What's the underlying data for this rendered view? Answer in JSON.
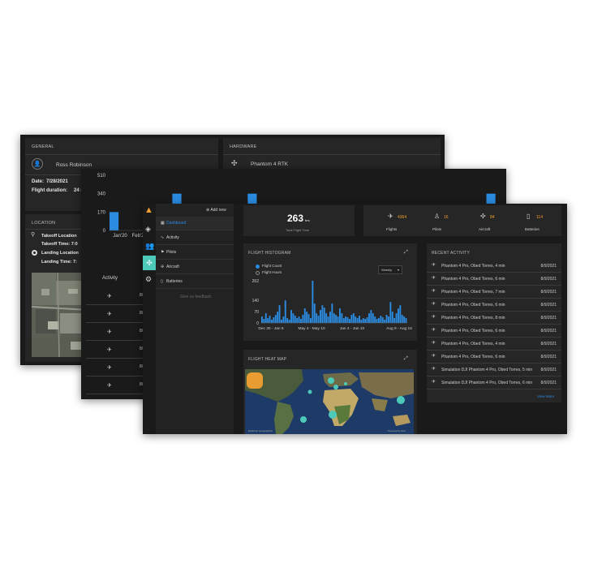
{
  "w1": {
    "general": {
      "title": "GENERAL",
      "pilot": "Ross Robinson",
      "date_label": "Date:",
      "date": "7/28/2021",
      "duration_label": "Flight duration:",
      "duration": "24 mi"
    },
    "hardware": {
      "title": "HARDWARE",
      "aircraft": "Phantom 4 RTK"
    },
    "location": {
      "title": "LOCATION",
      "takeoff_location": "Takeoff Location",
      "takeoff_time_label": "Takeoff Time: 7:0",
      "landing_location": "Landing Location",
      "landing_time_label": "Landing Time: 7:"
    }
  },
  "w2": {
    "chart_data": {
      "type": "bar",
      "yticks": [
        "510",
        "340",
        "170",
        "0"
      ],
      "xticks": [
        "Jan'20",
        "Feb'2"
      ],
      "ylim": [
        0,
        510
      ],
      "values": [
        170,
        0,
        0,
        0,
        0,
        340,
        0,
        0,
        90,
        0,
        0,
        340,
        0,
        0,
        0,
        0,
        0,
        0,
        0,
        0,
        0,
        0,
        0,
        0,
        0,
        0,
        0,
        0,
        60,
        150,
        340
      ]
    },
    "activity_header": "Activity",
    "row_prefix": "8/",
    "rows": 7
  },
  "w3": {
    "sidebar": {
      "add_label": "Add new",
      "items": [
        {
          "label": "Dashboard",
          "icon": "grid-icon"
        },
        {
          "label": "Activity",
          "icon": "pulse-icon"
        },
        {
          "label": "Pilots",
          "icon": "pilot-icon"
        },
        {
          "label": "Aircraft",
          "icon": "drone-icon"
        },
        {
          "label": "Batteries",
          "icon": "battery-icon"
        }
      ],
      "feedback": "Give us feedback"
    },
    "total_flight_time": {
      "value": "263",
      "unit": "hrs",
      "label": "Total Flight Time"
    },
    "stats": [
      {
        "value": "4364",
        "label": "Flights",
        "icon": "plane-icon"
      },
      {
        "value": "16",
        "label": "Pilots",
        "icon": "person-icon"
      },
      {
        "value": "84",
        "label": "Aircraft",
        "icon": "drone-icon"
      },
      {
        "value": "114",
        "label": "Batteries",
        "icon": "battery-icon"
      }
    ],
    "histogram": {
      "title": "FLIGHT HISTOGRAM",
      "option1": "Flight Count",
      "option2": "Flight Hours",
      "select": "Weekly"
    },
    "chart_data": {
      "type": "bar",
      "yticks": [
        "262",
        "140",
        "70",
        "0"
      ],
      "ylim": [
        0,
        262
      ],
      "xticks": [
        "Dec 30 - Jan 5",
        "May 4 - May 10",
        "Jan 4 - Jan 10",
        "Aug 9 - Aug 15"
      ],
      "values": [
        40,
        25,
        60,
        30,
        45,
        20,
        35,
        50,
        70,
        110,
        20,
        40,
        140,
        30,
        20,
        80,
        60,
        45,
        30,
        40,
        25,
        50,
        90,
        70,
        55,
        30,
        262,
        120,
        60,
        45,
        80,
        110,
        95,
        60,
        40,
        70,
        120,
        60,
        50,
        40,
        90,
        60,
        30,
        40,
        35,
        25,
        50,
        60,
        40,
        30,
        45,
        20,
        30,
        25,
        35,
        60,
        80,
        60,
        40,
        25,
        30,
        45,
        35,
        20,
        50,
        40,
        130,
        70,
        30,
        60,
        90,
        110,
        50,
        40,
        30
      ]
    },
    "heatmap": {
      "title": "FLIGHT HEAT MAP",
      "credit_left": "Earthstar Geographics",
      "credit_right": "Powered by Esri"
    },
    "recent": {
      "title": "RECENT ACTIVITY",
      "rows": [
        {
          "text": "Phantom 4 Pro, Obed Torres, 4 min",
          "date": "8/9/2021"
        },
        {
          "text": "Phantom 4 Pro, Obed Torres, 6 min",
          "date": "8/9/2021"
        },
        {
          "text": "Phantom 4 Pro, Obed Torres, 7 min",
          "date": "8/9/2021"
        },
        {
          "text": "Phantom 4 Pro, Obed Torres, 6 min",
          "date": "8/9/2021"
        },
        {
          "text": "Phantom 4 Pro, Obed Torres, 8 min",
          "date": "8/9/2021"
        },
        {
          "text": "Phantom 4 Pro, Obed Torres, 6 min",
          "date": "8/9/2021"
        },
        {
          "text": "Phantom 4 Pro, Obed Torres, 4 min",
          "date": "8/9/2021"
        },
        {
          "text": "Phantom 4 Pro, Obed Torres, 6 min",
          "date": "8/9/2021"
        },
        {
          "text": "Simulation DJI Phantom 4 Pro, Obed Torres, 5 min",
          "date": "8/9/2021"
        },
        {
          "text": "Simulation DJI Phantom 4 Pro, Obed Torres, 6 min",
          "date": "8/9/2021"
        }
      ],
      "view_more": "View More"
    },
    "colors": {
      "accent": "#2b8be0",
      "orange": "#f0a030",
      "bar": "#2b8be0",
      "teal": "#4cc9b8"
    }
  }
}
